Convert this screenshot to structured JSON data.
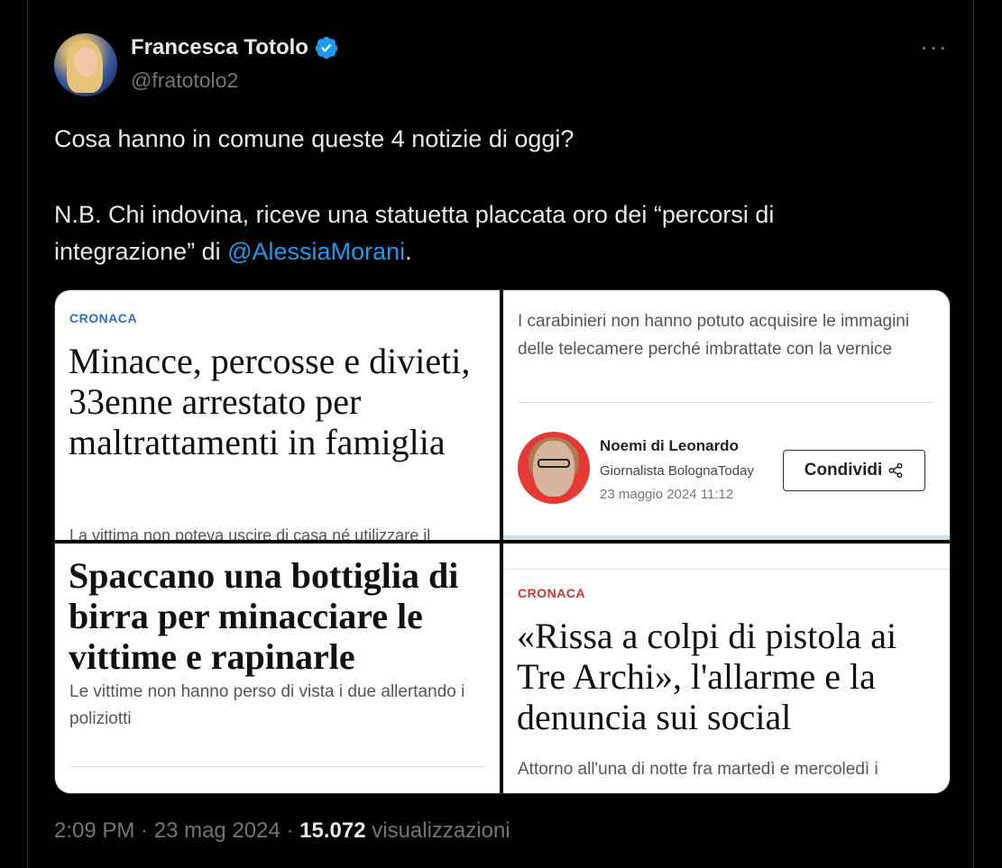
{
  "author": {
    "name": "Francesca Totolo",
    "handle": "@fratotolo2"
  },
  "icons": {
    "verified": "verified-badge-icon",
    "more": "more-options-icon",
    "share": "share-icon"
  },
  "colors": {
    "background": "#000000",
    "text": "#e7e9ea",
    "muted": "#71767b",
    "link": "#1d9bf0",
    "verified": "#1d9bf0"
  },
  "tweet": {
    "line1": "Cosa hanno in comune queste 4 notizie di oggi?",
    "line2_prefix": "N.B. Chi indovina, riceve una statuetta placcata oro dei “percorsi di integrazione” di ",
    "mention": "@AlessiaMorani",
    "line2_suffix": "."
  },
  "media": {
    "panel1": {
      "kicker": "CRONACA",
      "headline": "Minacce, percosse e divieti, 33enne arrestato per maltrattamenti in famiglia",
      "cut_text": "La vittima non poteva uscire di casa né utilizzare il"
    },
    "panel2": {
      "lead": "I carabinieri non hanno potuto acquisire le immagini delle telecamere perché imbrattate con la vernice",
      "author_name": "Noemi di Leonardo",
      "author_role": "Giornalista BolognaToday",
      "date": "23 maggio 2024 11:12",
      "share_label": "Condividi"
    },
    "panel3": {
      "headline": "Spaccano una bottiglia di birra per minacciare le vittime e rapinarle",
      "subtitle": "Le vittime non hanno perso di vista i due allertando i poliziotti"
    },
    "panel4": {
      "kicker": "CRONACA",
      "headline": "«Rissa a colpi di pistola ai Tre Archi», l'allarme e la denuncia sui social",
      "subtitle": "Attorno all'una di notte fra martedì e mercoledì i"
    }
  },
  "meta": {
    "time": "2:09 PM",
    "sep1": " · ",
    "date": "23 mag 2024",
    "sep2": " · ",
    "views": "15.072",
    "views_label": " visualizzazioni"
  }
}
